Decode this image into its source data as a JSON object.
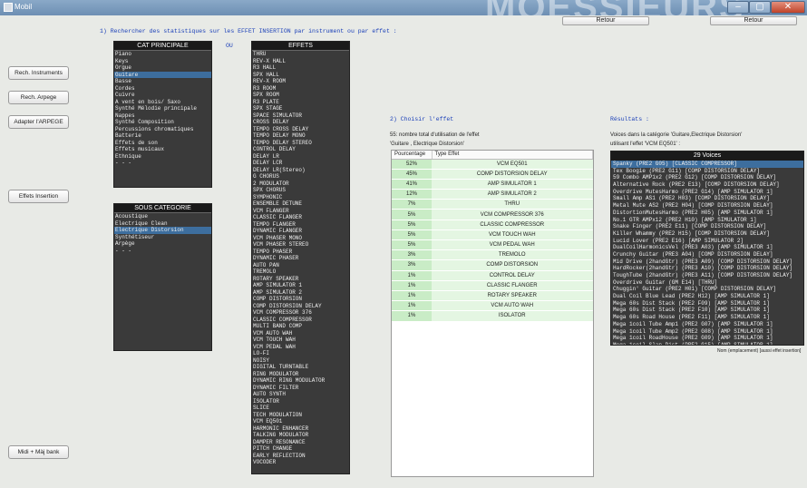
{
  "window": {
    "title": "Mobil",
    "logo_text": "MOESSIEURS",
    "minimize": "–",
    "maximize": "▢",
    "close": "✕"
  },
  "retour": [
    "Retour",
    "Retour"
  ],
  "headings": {
    "step1": "1) Rechercher des statistiques sur les EFFET INSERTION par instrument ou par effet :",
    "step2": "2) Choisir l'effet",
    "results": "Résultats :",
    "ou": "OU"
  },
  "side_buttons": [
    "Rech. Instruments",
    "Rech. Arpege",
    "Adapter l'ARPEGE",
    "Effets Insertion",
    "Midi + Màj bank"
  ],
  "cat_principale": {
    "header": "CAT PRINCIPALE",
    "items": [
      "Piano",
      "Keys",
      "Orgue",
      "Guitare",
      "Basse",
      "Cordes",
      "Cuivre",
      "A vent en bois/ Saxo",
      "Synthé Mélodie principale",
      "Nappes",
      "Synthé Composition",
      "Percussions chromatiques",
      "Batterie",
      "Effets de son",
      "Effets musicaux",
      "Ethnique",
      "- - -"
    ],
    "selected": 3
  },
  "sous_categorie": {
    "header": "SOUS CATEGORIE",
    "items": [
      "Acoustique",
      "Electrique Clean",
      "Electrique Distorsion",
      "Synthétiseur",
      "Arpège",
      "- - -"
    ],
    "selected": 2
  },
  "effets": {
    "header": "EFFETS",
    "items": [
      "THRU",
      "REV-X HALL",
      "R3 HALL",
      "SPX HALL",
      "REV-X ROOM",
      "R3 ROOM",
      "SPX ROOM",
      "R3 PLATE",
      "SPX STAGE",
      "SPACE SIMULATOR",
      "CROSS DELAY",
      "TEMPO CROSS DELAY",
      "TEMPO DELAY MONO",
      "TEMPO DELAY STEREO",
      "CONTROL DELAY",
      "DELAY LR",
      "DELAY LCR",
      "DELAY LR(Stereo)",
      "G CHORUS",
      "2 MODULATOR",
      "SPX CHORUS",
      "SYMPHONIC",
      "ENSEMBLE DETUNE",
      "VCM FLANGER",
      "CLASSIC FLANGER",
      "TEMPO FLANGER",
      "DYNAMIC FLANGER",
      "VCM PHASER MONO",
      "VCM PHASER STEREO",
      "TEMPO PHASER",
      "DYNAMIC PHASER",
      "AUTO PAN",
      "TREMOLO",
      "ROTARY SPEAKER",
      "AMP SIMULATOR 1",
      "AMP SIMULATOR 2",
      "COMP DISTORSION",
      "COMP DISTORSION DELAY",
      "VCM COMPRESSOR 376",
      "CLASSIC COMPRESSOR",
      "MULTI BAND COMP",
      "VCM AUTO WAH",
      "VCM TOUCH WAH",
      "VCM PEDAL WAH",
      "LO-FI",
      "NOISY",
      "DIGITAL TURNTABLE",
      "RING MODULATOR",
      "DYNAMIC RING MODULATOR",
      "DYNAMIC FILTER",
      "AUTO SYNTH",
      "ISOLATOR",
      "SLICE",
      "TECH MODULATION",
      "VCM EQ501",
      "HARMONIC ENHANCER",
      "TALKING MODULATOR",
      "DAMPER RESONANCE",
      "PITCH CHANGE",
      "EARLY REFLECTION",
      "VOCODER"
    ]
  },
  "choix": {
    "count_label": "55: nombre total d'utilisation de l'effet",
    "category_label": "'Guitare , Electrique Distorsion'",
    "col_pct": "Pourcentage",
    "col_eff": "Type Effet",
    "rows": [
      [
        "52%",
        "VCM EQ501"
      ],
      [
        "45%",
        "COMP DISTORSION DELAY"
      ],
      [
        "41%",
        "AMP SIMULATOR 1"
      ],
      [
        "12%",
        "AMP SIMULATOR 2"
      ],
      [
        "7%",
        "THRU"
      ],
      [
        "5%",
        "VCM COMPRESSOR 376"
      ],
      [
        "5%",
        "CLASSIC COMPRESSOR"
      ],
      [
        "5%",
        "VCM TOUCH WAH"
      ],
      [
        "5%",
        "VCM PEDAL WAH"
      ],
      [
        "3%",
        "TREMOLO"
      ],
      [
        "3%",
        "COMP DISTORSION"
      ],
      [
        "1%",
        "CONTROL DELAY"
      ],
      [
        "1%",
        "CLASSIC FLANGER"
      ],
      [
        "1%",
        "ROTARY SPEAKER"
      ],
      [
        "1%",
        "VCM AUTO WAH"
      ],
      [
        "1%",
        "ISOLATOR"
      ]
    ]
  },
  "results": {
    "line1": "Voices dans la catégorie 'Guitare,Electrique Distorsion'",
    "line2": "utilisant l'effet 'VCM EQ501' :",
    "header": "29 Voices",
    "items": [
      "Spanky (PRE2 G05) [CLASSIC COMPRESSOR]",
      "Tex Boogie (PRE2 G11) [COMP DISTORSION DELAY]",
      "59 Combo AMP1x2 (PRE2 G12) [COMP DISTORSION DELAY]",
      "Alternative Rock (PRE2 E13) [COMP DISTORSION DELAY]",
      "Overdrive MutesHarmo (PRE2 G14) [AMP SIMULATOR 1]",
      "Small Amp AS1 (PRE2 H03) [COMP DISTORSION DELAY]",
      "Metal Mute AS2 (PRE2 H04) [COMP DISTORSION DELAY]",
      "DistortionMutesHarmo (PRE2 H05) [AMP SIMULATOR 1]",
      "No.1 GTR AMPx12 (PRE2 H10) [AMP SIMULATOR 1]",
      "Snake Finger (PRE2 E11) [COMP DISTORSION DELAY]",
      "Killer Whammy (PRE2 H15) [COMP DISTORSION DELAY]",
      "Lucid Lover (PRE2 E16) [AMP SIMULATOR 2]",
      "DualCoilHarmonicsVel (PRE3 A03) [AMP SIMULATOR 1]",
      "Crunchy Guitar (PRE3 A04) [COMP DISTORSION DELAY]",
      "Mid Drive (2handGtr) (PRE3 A09) [COMP DISTORSION DELAY]",
      "HardRocker(2handGtr) (PRE3 A10) [COMP DISTORSION DELAY]",
      "ToughTube (2handGtr) (PRE3 A11) [COMP DISTORSION DELAY]",
      "Overdrive Guitar (GM E14) [THRU]",
      "Chuggin' Guitar (PRE2 H01) [COMP DISTORSION DELAY]",
      "Dual Coil Blue Lead (PRE2 H12) [AMP SIMULATOR 1]",
      "Mega 60s Dist Stack (PRE2 F09) [AMP SIMULATOR 1]",
      "Mega 60s Dist Stack (PRE2 F10) [AMP SIMULATOR 1]",
      "Mega 60s Road House (PRE2 F11) [AMP SIMULATOR 1]",
      "Mega 1coil Tube Amp1 (PRE2 G07) [AMP SIMULATOR 1]",
      "Mega 1coil Tube Amp2 (PRE2 G08) [AMP SIMULATOR 1]",
      "Mega 1coil RoadHouse (PRE2 G09) [AMP SIMULATOR 1]",
      "Mega 1coil Slap Dist (PRE2 G15) [AMP SIMULATOR 1]"
    ],
    "selected": 0,
    "footer": "Nom (emplacement) [aussi effet insertion]"
  }
}
